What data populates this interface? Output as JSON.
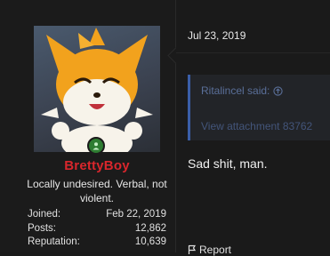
{
  "user": {
    "username": "BrettyBoy",
    "title": "Locally undesired. Verbal, not violent.",
    "stats": [
      {
        "label": "Joined:",
        "value": "Feb 22, 2019"
      },
      {
        "label": "Posts:",
        "value": "12,862"
      },
      {
        "label": "Reputation:",
        "value": "10,639"
      }
    ],
    "username_color": "#d9262c",
    "online_badge_color": "#2e7d32"
  },
  "post": {
    "date": "Jul 23, 2019",
    "quote": {
      "author": "Ritalincel said:",
      "link_text": "View attachment 83762"
    },
    "body": "Sad shit, man.",
    "actions": {
      "report_label": "Report"
    }
  },
  "icons": {
    "quote_jump": "arrow-up-circle-icon",
    "report": "flag-icon",
    "online": "person-icon"
  }
}
